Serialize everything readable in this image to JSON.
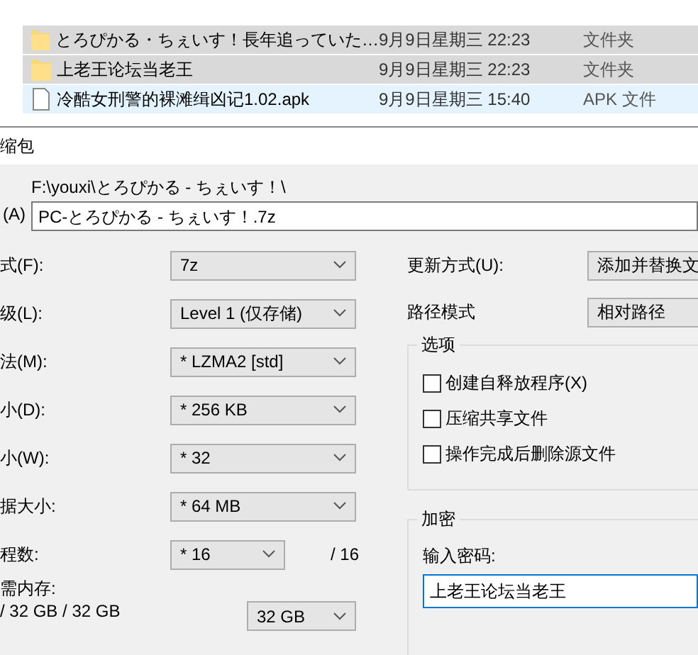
{
  "file_list": {
    "rows": [
      {
        "kind": "folder",
        "name": "とろぴかる・ちぇいす！長年追っていた…",
        "date": "9月9日星期三 22:23",
        "type": "文件夹",
        "selected": true,
        "hovered": false
      },
      {
        "kind": "folder",
        "name": "上老王论坛当老王",
        "date": "9月9日星期三 22:23",
        "type": "文件夹",
        "selected": true,
        "hovered": false
      },
      {
        "kind": "file",
        "name": "冷酷女刑警的裸滩缉凶记1.02.apk",
        "date": "9月9日星期三 15:40",
        "type": "APK 文件",
        "selected": false,
        "hovered": true
      }
    ]
  },
  "dialog": {
    "title": "缩包",
    "archive_label": "(A)",
    "archive_path": "F:\\youxi\\とろぴかる - ちぇいす！\\",
    "archive_name": "PC-とろぴかる - ちぇいす！.7z",
    "left_options": [
      {
        "label": "式(F):",
        "value": "7z"
      },
      {
        "label": "级(L):",
        "value": "Level 1 (仅存储)"
      },
      {
        "label": "法(M):",
        "value": "* LZMA2 [std]"
      },
      {
        "label": "小(D):",
        "value": "* 256 KB"
      },
      {
        "label": "小(W):",
        "value": "* 32"
      },
      {
        "label": "据大小:",
        "value": "* 64 MB"
      }
    ],
    "threads": {
      "label": "程数:",
      "value": "* 16",
      "max": "/ 16"
    },
    "memory": {
      "label": "需内存:",
      "usage": "/ 32 GB / 32 GB",
      "value": "32 GB"
    },
    "update_mode": {
      "label": "更新方式(U):",
      "value": "添加并替换文"
    },
    "path_mode": {
      "label": "路径模式",
      "value": "相对路径"
    },
    "options": {
      "title": "选项",
      "items": [
        {
          "label": "创建自释放程序(X)",
          "checked": false
        },
        {
          "label": "压缩共享文件",
          "checked": false
        },
        {
          "label": "操作完成后删除源文件",
          "checked": false
        }
      ]
    },
    "encryption": {
      "title": "加密",
      "password_label": "输入密码:",
      "password": "上老王论坛当老王",
      "focused": true
    }
  }
}
